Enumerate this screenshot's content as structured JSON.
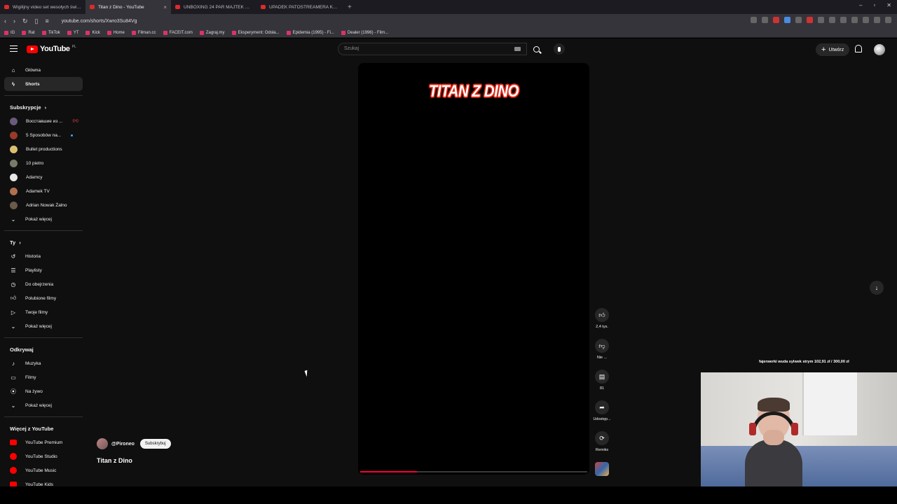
{
  "browser": {
    "tabs": [
      {
        "label": "Wigilijny video set wesołych świąt ko",
        "active": false
      },
      {
        "label": "Titan z Dino - YouTube",
        "active": true
      },
      {
        "label": "UNBOXING 24 PAR MAJTEK ZE SKIM",
        "active": false
      },
      {
        "label": "UPADEK PATOSTREAMERA Którego C",
        "active": false
      }
    ],
    "url": "youtube.com/shorts/Xwro3Su84Vg",
    "bookmarks": [
      "IG",
      "Rat",
      "TikTok",
      "YT",
      "Kick",
      "Home",
      "Filman.cc",
      "FACEIT.com",
      "Zagraj.my",
      "Eksperyment: Odsła...",
      "Epidemia (1995) - Fi...",
      "Dealer (1996) - Film..."
    ]
  },
  "header": {
    "logo_text": "YouTube",
    "logo_country": "PL",
    "search_placeholder": "Szukaj",
    "create_label": "Utwórz"
  },
  "sidebar": {
    "main": [
      {
        "label": "Główna",
        "icon": "home-icon"
      },
      {
        "label": "Shorts",
        "icon": "shorts-icon",
        "active": true
      }
    ],
    "subscriptions_title": "Subskrypcje",
    "subscriptions": [
      {
        "label": "Восставшие из ...",
        "color": "#6a5a7a",
        "live": "((•))"
      },
      {
        "label": "5 Sposobów na...",
        "color": "#9a3a2a",
        "dot": true
      },
      {
        "label": "Bullet productions",
        "color": "#d8c070"
      },
      {
        "label": "10 pietro",
        "color": "#7a7a6a"
      },
      {
        "label": "Adamcy",
        "color": "#e8e8e8"
      },
      {
        "label": "Adamek TV",
        "color": "#b07050"
      },
      {
        "label": "Adrian Nowak Żalno",
        "color": "#6a5a4a"
      }
    ],
    "show_more": "Pokaż więcej",
    "you_title": "Ty",
    "you": [
      {
        "label": "Historia",
        "icon": "history-icon"
      },
      {
        "label": "Playlisty",
        "icon": "playlist-icon"
      },
      {
        "label": "Do obejrzenia",
        "icon": "watch-later-icon"
      },
      {
        "label": "Polubione filmy",
        "icon": "like-icon"
      },
      {
        "label": "Twoje filmy",
        "icon": "your-videos-icon"
      }
    ],
    "explore_title": "Odkrywaj",
    "explore": [
      {
        "label": "Muzyka",
        "icon": "music-icon"
      },
      {
        "label": "Filmy",
        "icon": "movies-icon"
      },
      {
        "label": "Na żywo",
        "icon": "live-icon"
      }
    ],
    "more_title": "Więcej z YouTube",
    "more": [
      {
        "label": "YouTube Premium"
      },
      {
        "label": "YouTube Studio"
      },
      {
        "label": "YouTube Music"
      },
      {
        "label": "YouTube Kids"
      }
    ]
  },
  "short": {
    "overlay_title": "TITAN Z DINO",
    "progress": 0.25,
    "channel_handle": "@Pironeo",
    "subscribe_label": "Subskrybuj",
    "title": "Titan z Dino"
  },
  "actions": {
    "likes": "2,4 tys.",
    "dislike": "Nie ...",
    "comments": "81",
    "share": "Udostęp...",
    "remix": "Remiks"
  },
  "stream_overlay": {
    "ticker": "fajerwerki wuda sylwek strym  102,91 zł  /  300,00 zł"
  }
}
